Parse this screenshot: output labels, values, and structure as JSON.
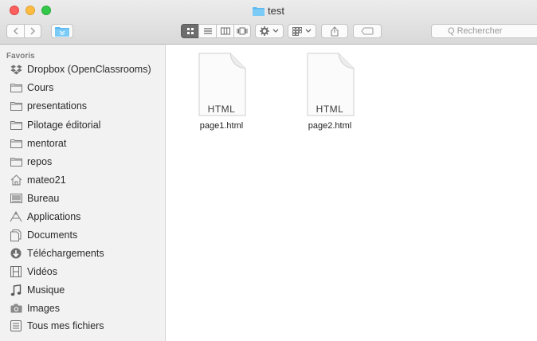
{
  "window": {
    "title": "test"
  },
  "search": {
    "placeholder": "Q Rechercher"
  },
  "sidebar": {
    "section": "Favoris",
    "items": [
      {
        "label": "Dropbox (OpenClassrooms)",
        "icon": "dropbox-icon"
      },
      {
        "label": "Cours",
        "icon": "folder-icon"
      },
      {
        "label": "presentations",
        "icon": "folder-icon"
      },
      {
        "label": "Pilotage éditorial",
        "icon": "folder-icon"
      },
      {
        "label": "mentorat",
        "icon": "folder-icon"
      },
      {
        "label": "repos",
        "icon": "folder-icon"
      },
      {
        "label": "mateo21",
        "icon": "home-icon"
      },
      {
        "label": "Bureau",
        "icon": "desktop-icon"
      },
      {
        "label": "Applications",
        "icon": "applications-icon"
      },
      {
        "label": "Documents",
        "icon": "documents-icon"
      },
      {
        "label": "Téléchargements",
        "icon": "downloads-icon"
      },
      {
        "label": "Vidéos",
        "icon": "film-icon"
      },
      {
        "label": "Musique",
        "icon": "music-icon"
      },
      {
        "label": "Images",
        "icon": "camera-icon"
      },
      {
        "label": "Tous mes fichiers",
        "icon": "all-files-icon"
      }
    ]
  },
  "files": [
    {
      "name": "page1.html",
      "type_label": "HTML"
    },
    {
      "name": "page2.html",
      "type_label": "HTML"
    }
  ],
  "colors": {
    "close": "#fc605c",
    "minimize": "#fdbc40",
    "maximize": "#34c84a",
    "folder": "#5ab9f0"
  }
}
